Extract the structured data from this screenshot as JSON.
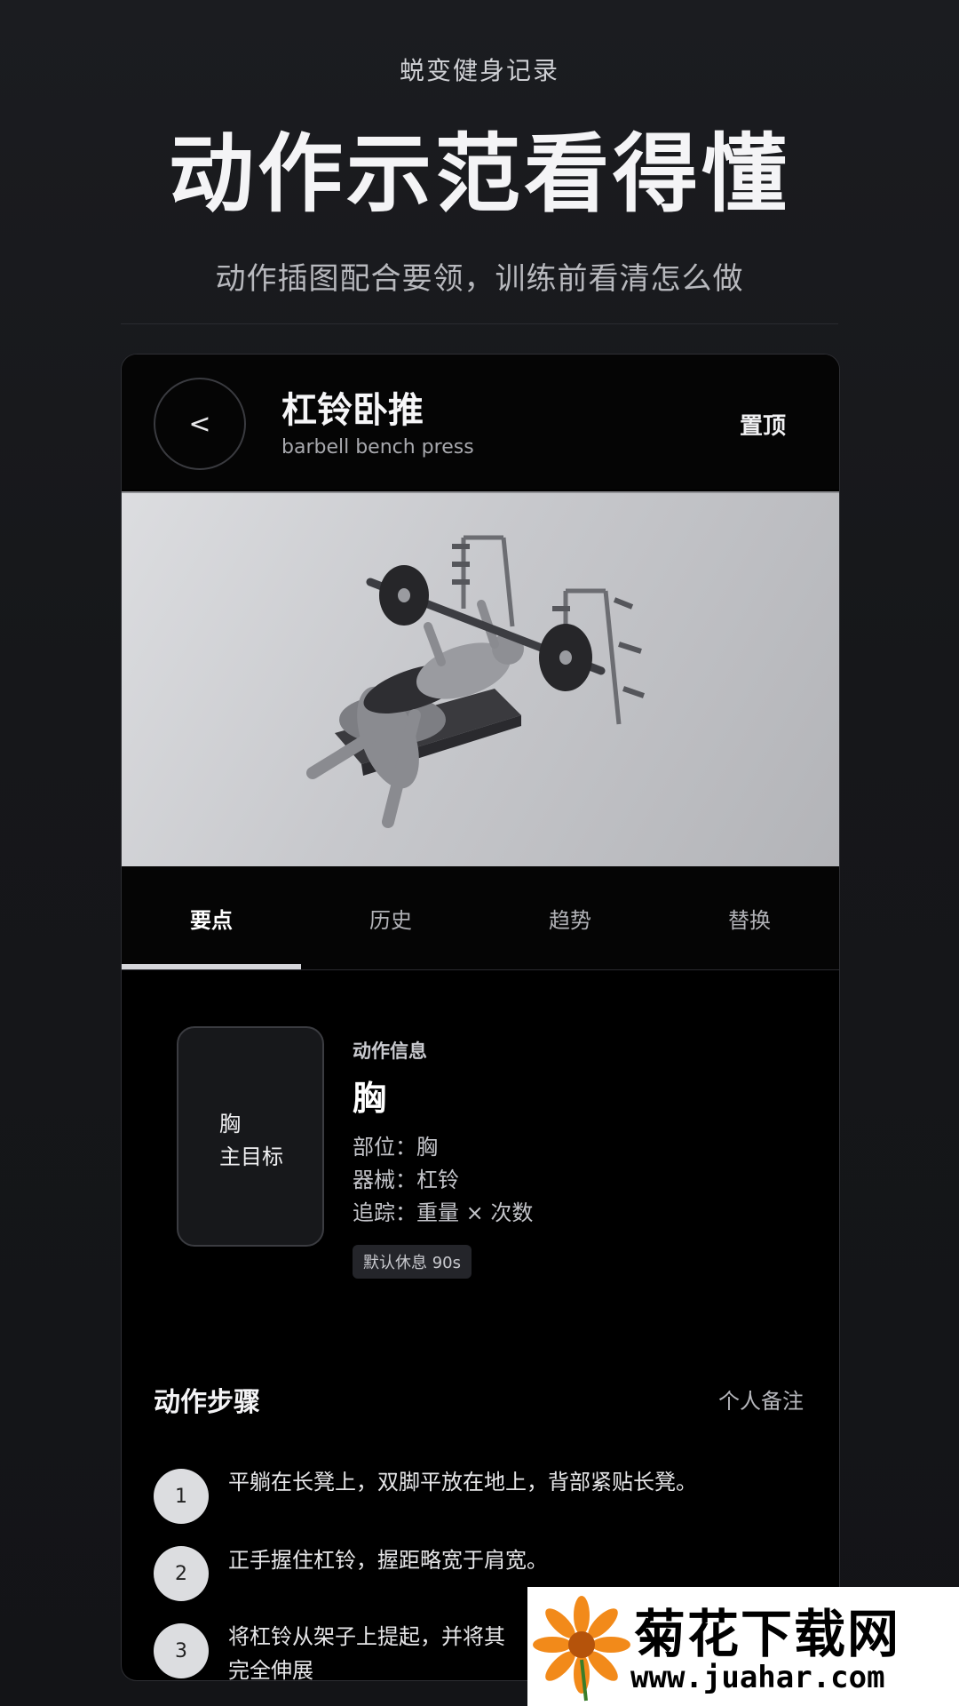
{
  "promo": {
    "app_name": "蜕变健身记录",
    "headline": "动作示范看得懂",
    "description": "动作插图配合要领，训练前看清怎么做"
  },
  "header": {
    "back_glyph": "<",
    "exercise_name": "杠铃卧推",
    "exercise_name_en": "barbell bench press",
    "pin_label": "置顶"
  },
  "illustration": {
    "icon": "bench-press-illustration"
  },
  "tabs": [
    {
      "label": "要点",
      "active": true
    },
    {
      "label": "历史",
      "active": false
    },
    {
      "label": "趋势",
      "active": false
    },
    {
      "label": "替换",
      "active": false
    }
  ],
  "info": {
    "card_line1": "胸",
    "card_line2": "主目标",
    "section_label": "动作信息",
    "muscle": "胸",
    "part": "部位：胸",
    "equipment": "器械：杠铃",
    "tracking": "追踪：重量 × 次数",
    "rest_badge": "默认休息 90s"
  },
  "steps": {
    "title": "动作步骤",
    "notes_label": "个人备注",
    "items": [
      {
        "num": "1",
        "text": "平躺在长凳上，双脚平放在地上，背部紧贴长凳。"
      },
      {
        "num": "2",
        "text": "正手握住杠铃，握距略宽于肩宽。"
      },
      {
        "num": "3",
        "text": "将杠铃从架子上提起，并将其"
      },
      {
        "num": "",
        "text": "完全伸展"
      }
    ]
  },
  "watermark": {
    "title": "菊花下载网",
    "url": "www.juahar.com",
    "icon": "daisy-flower-icon"
  },
  "colors": {
    "background": "#16171a",
    "panel": "#000000",
    "accent_underline": "#d6d7db",
    "flower_orange": "#f28a1a"
  }
}
